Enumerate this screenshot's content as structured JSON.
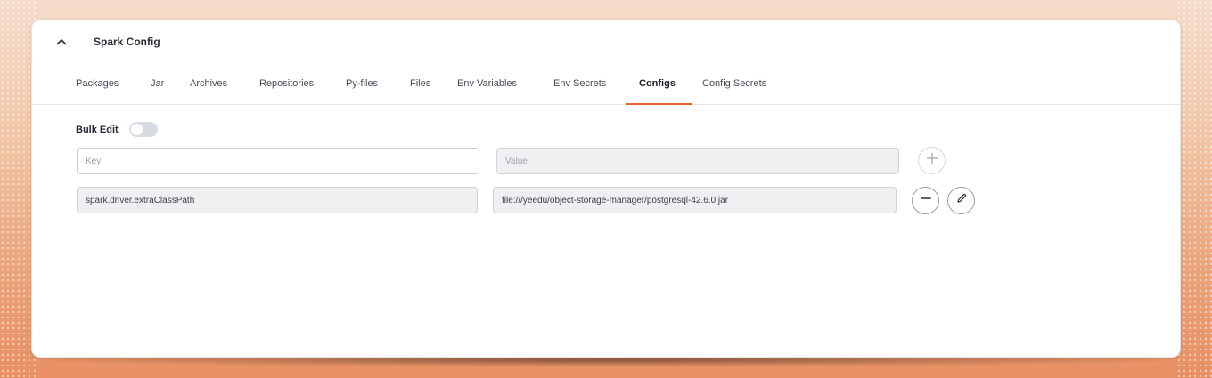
{
  "section": {
    "title": "Spark Config",
    "collapse_icon": "chevron-up-icon"
  },
  "tabs": [
    {
      "label": "Packages"
    },
    {
      "label": "Jar"
    },
    {
      "label": "Archives"
    },
    {
      "label": "Repositories"
    },
    {
      "label": "Py-files"
    },
    {
      "label": "Files"
    },
    {
      "label": "Env Variables"
    },
    {
      "label": "Env Secrets"
    },
    {
      "label": "Configs"
    },
    {
      "label": "Config Secrets"
    }
  ],
  "active_tab": "Configs",
  "bulk_edit": {
    "label": "Bulk Edit",
    "enabled": false
  },
  "new_entry": {
    "key_placeholder": "Key",
    "value_placeholder": "Value",
    "add_icon": "plus-icon"
  },
  "entries": [
    {
      "key": "spark.driver.extraClassPath",
      "value": "file:///yeedu/object-storage-manager/postgresql-42.6.0.jar",
      "remove_icon": "minus-icon",
      "edit_icon": "pencil-icon"
    }
  ],
  "colors": {
    "accent": "#e8632b",
    "toggle_off": "#d7dbe3"
  }
}
